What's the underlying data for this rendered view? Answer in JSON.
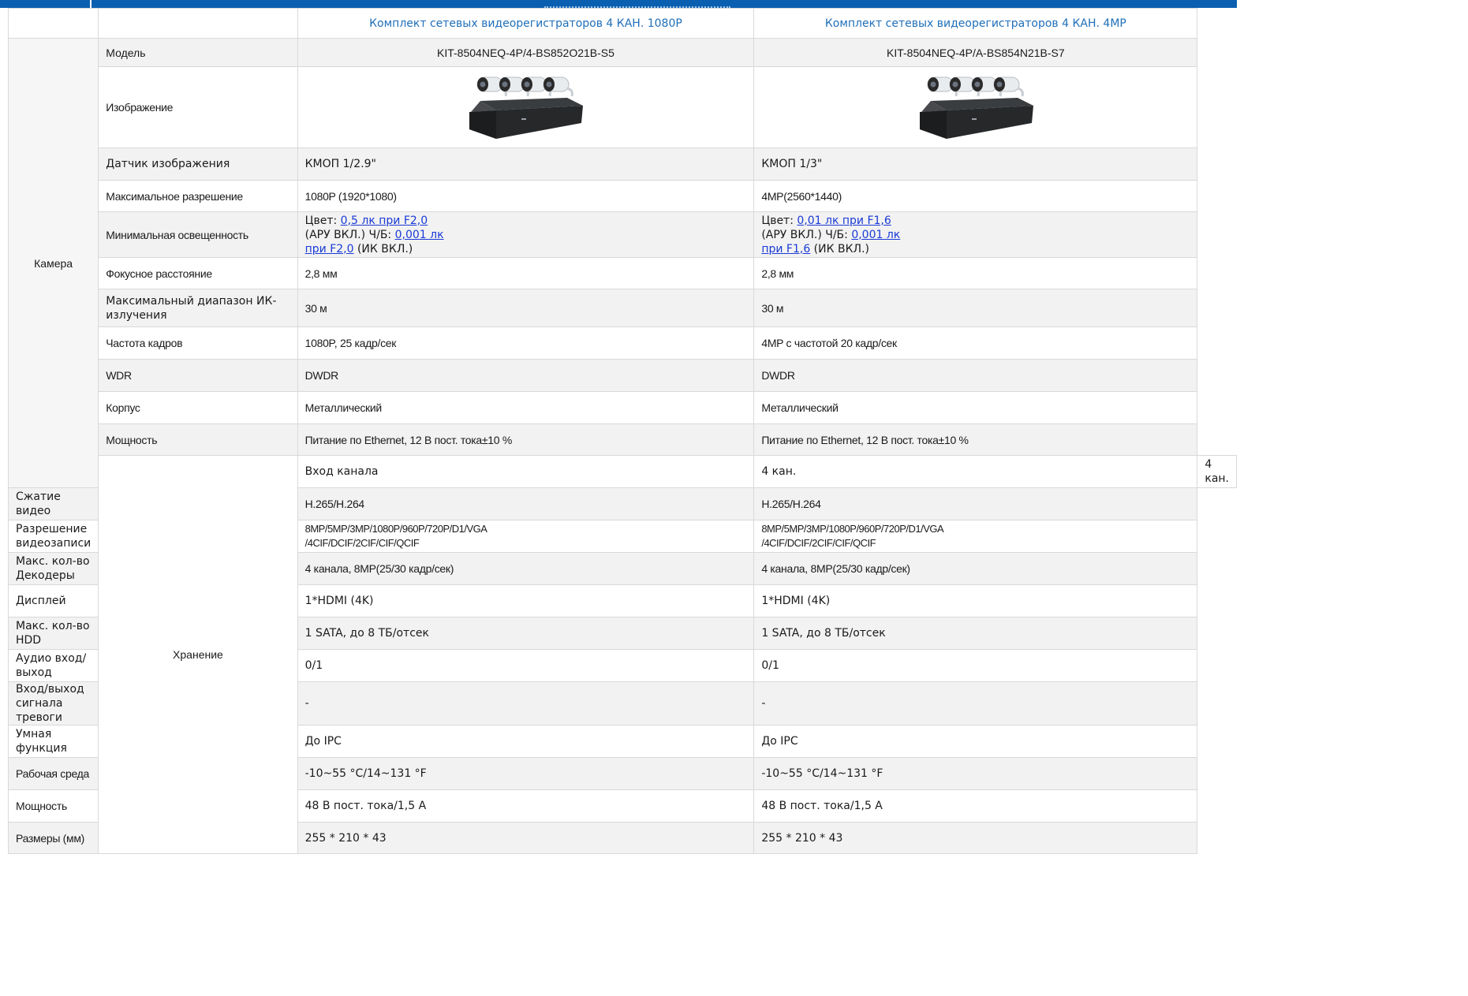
{
  "columns": {
    "col1_title": "Комплект сетевых видеорегистраторов 4 КАН. 1080P",
    "col2_title": "Комплект сетевых видеорегистраторов 4 КАН. 4MP"
  },
  "groups": {
    "camera": "Камера",
    "storage": "Хранение"
  },
  "model": {
    "label": "Модель",
    "col1": "KIT-8504NEQ-4P/4-BS852O21B-S5",
    "col2": "KIT-8504NEQ-4P/A-BS854N21B-S7"
  },
  "image_row": {
    "label": "Изображение"
  },
  "camera_rows": [
    {
      "label": "Датчик изображения",
      "col1": "КМОП 1/2.9\"",
      "col2": "КМОП 1/3\""
    },
    {
      "label": "Максимальное разрешение",
      "col1": "1080P (1920*1080)",
      "col2": "4MP(2560*1440)"
    },
    {
      "label": "Минимальная освещенность"
    },
    {
      "label": "Фокусное расстояние",
      "col1": "2,8 мм",
      "col2": "2,8 мм"
    },
    {
      "label": "Максимальный диапазон ИК-излучения",
      "col1": "30 м",
      "col2": "30 м"
    },
    {
      "label": "Частота кадров",
      "col1": "1080P, 25 кадр/сек",
      "col2": "4MP с частотой 20 кадр/сек"
    },
    {
      "label": "WDR",
      "col1": "DWDR",
      "col2": "DWDR"
    },
    {
      "label": "Корпус",
      "col1": "Металлический",
      "col2": "Металлический"
    },
    {
      "label": "Мощность",
      "col1": "Питание по Ethernet, 12 В пост. тока±10 %",
      "col2": "Питание по Ethernet, 12 В пост. тока±10 %"
    }
  ],
  "illumination": {
    "col1": {
      "color_prefix": "Цвет: ",
      "color_link": "0,5 лк при F2,0",
      "mid": "(АРУ ВКЛ.) Ч/Б: ",
      "bw_link_a": "0,001 лк",
      "bw_link_b": "при F2,0",
      "suffix": " (ИК ВКЛ.)"
    },
    "col2": {
      "color_prefix": "Цвет: ",
      "color_link": "0,01 лк при F1,6",
      "mid": "(АРУ ВКЛ.) Ч/Б: ",
      "bw_link_a": "0,001 лк",
      "bw_link_b": "при F1,6",
      "suffix": " (ИК ВКЛ.)"
    }
  },
  "storage_rows": [
    {
      "label": "Вход канала",
      "col1": "4 кан.",
      "col2": "4 кан."
    },
    {
      "label": "Сжатие видео",
      "col1": "H.265/H.264",
      "col2": "H.265/H.264"
    },
    {
      "label": "Разрешение видеозаписи",
      "col1_a": "8MP/5MP/3MP/1080P/960P/720P/D1/VGA",
      "col1_b": "/4CIF/DCIF/2CIF/CIF/QCIF",
      "col2_a": "8MP/5MP/3MP/1080P/960P/720P/D1/VGA",
      "col2_b": "/4CIF/DCIF/2CIF/CIF/QCIF"
    },
    {
      "label": "Макс. кол-во Декодеры",
      "col1": "4 канала, 8MP(25/30 кадр/сек)",
      "col2": "4 канала, 8MP(25/30 кадр/сек)"
    },
    {
      "label": "Дисплей",
      "col1": "1*HDMI (4K)",
      "col2": "1*HDMI (4K)"
    },
    {
      "label": "Макс. кол-во HDD",
      "col1": "1 SATA, до 8 ТБ/отсек",
      "col2": "1 SATA, до 8 ТБ/отсек"
    },
    {
      "label": "Аудио вход/выход",
      "col1": "0/1",
      "col2": "0/1"
    },
    {
      "label": "Вход/выход сигнала тревоги",
      "col1": "-",
      "col2": "-"
    },
    {
      "label": "Умная функция",
      "col1": "До IPC",
      "col2": "До IPC"
    },
    {
      "label": "Рабочая среда",
      "col1": "-10~55 °C/14~131 °F",
      "col2": "-10~55 °C/14~131 °F"
    },
    {
      "label": "Мощность",
      "col1": "48 В пост. тока/1,5 А",
      "col2": "48 В пост. тока/1,5 А"
    },
    {
      "label": "Размеры (мм)",
      "col1": "255 * 210 * 43",
      "col2": "255 * 210 * 43"
    }
  ]
}
